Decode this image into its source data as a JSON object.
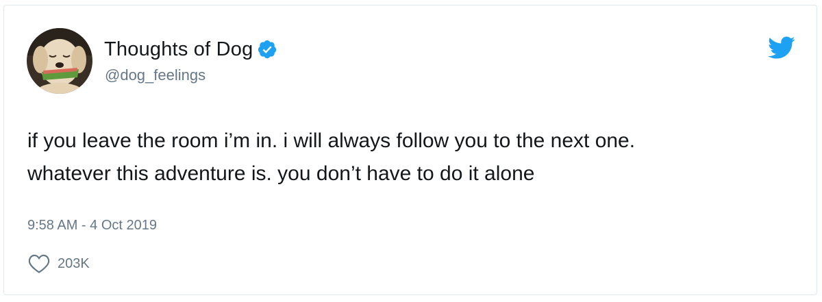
{
  "user": {
    "display_name": "Thoughts of Dog",
    "handle": "@dog_feelings",
    "verified": true,
    "avatar_icon": "dog-avatar"
  },
  "tweet": {
    "text": "if you leave the room i’m in. i will always follow you to the next one.\nwhatever this adventure is. you don’t have to do it alone",
    "timestamp": "9:58 AM - 4 Oct 2019",
    "likes": "203K"
  },
  "icons": {
    "verified": "verified-badge-icon",
    "brand": "twitter-bird-icon",
    "like": "heart-icon"
  },
  "colors": {
    "brand_blue": "#1da1f2",
    "secondary_text": "#657786",
    "primary_text": "#14171a",
    "border": "#e1e8ed"
  }
}
